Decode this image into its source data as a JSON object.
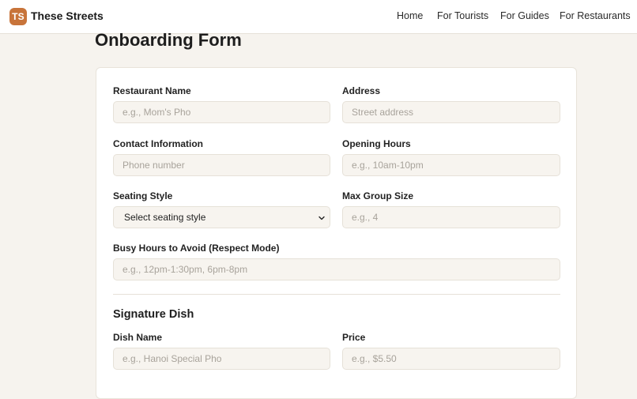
{
  "header": {
    "logo_text": "TS",
    "brand": "These Streets",
    "nav": [
      "Home",
      "For Tourists",
      "For Guides",
      "For Restaurants"
    ]
  },
  "page": {
    "title": "Onboarding Form"
  },
  "form": {
    "restaurant_name": {
      "label": "Restaurant Name",
      "placeholder": "e.g., Mom's Pho"
    },
    "address": {
      "label": "Address",
      "placeholder": "Street address"
    },
    "contact": {
      "label": "Contact Information",
      "placeholder": "Phone number"
    },
    "hours": {
      "label": "Opening Hours",
      "placeholder": "e.g., 10am-10pm"
    },
    "seating": {
      "label": "Seating Style",
      "selected": "Select seating style"
    },
    "group_size": {
      "label": "Max Group Size",
      "placeholder": "e.g., 4"
    },
    "busy_hours": {
      "label": "Busy Hours to Avoid (Respect Mode)",
      "placeholder": "e.g., 12pm-1:30pm, 6pm-8pm"
    }
  },
  "signature": {
    "title": "Signature Dish",
    "dish_name": {
      "label": "Dish Name",
      "placeholder": "e.g., Hanoi Special Pho"
    },
    "price": {
      "label": "Price",
      "placeholder": "e.g., $5.50"
    }
  },
  "colors": {
    "brand": "#c8743a",
    "background": "#f6f3ee",
    "field_bg": "#f7f4ef"
  }
}
